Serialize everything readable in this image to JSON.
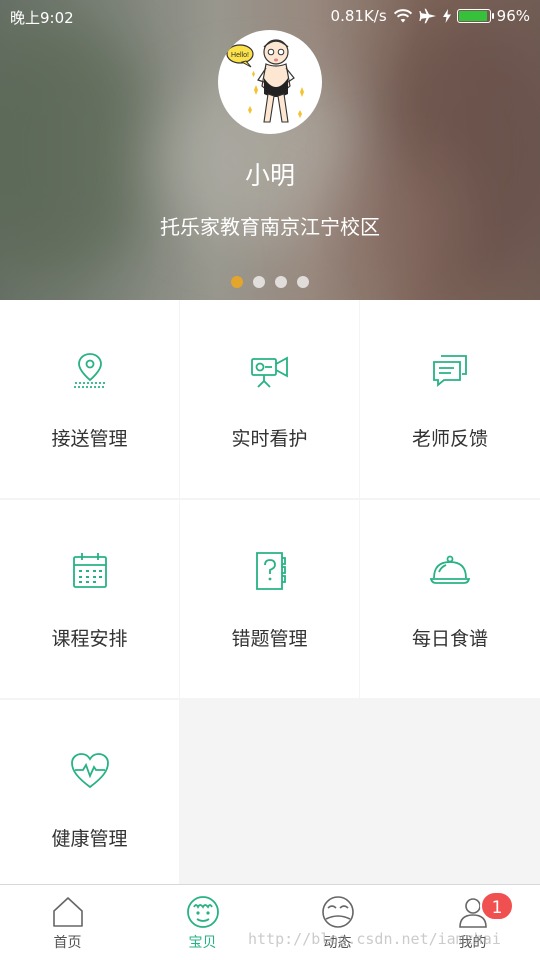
{
  "status_bar": {
    "time": "晚上9:02",
    "network_speed": "0.81K/s",
    "battery_percent": "96%",
    "battery_level": 0.96,
    "icons": [
      "wifi-icon",
      "airplane-icon",
      "charging-icon",
      "battery-icon"
    ]
  },
  "profile": {
    "name": "小明",
    "school": "托乐家教育南京江宁校区",
    "avatar_bubble": "Hello!"
  },
  "carousel": {
    "count": 4,
    "active_index": 0,
    "active_color": "#e4a52b"
  },
  "features": [
    {
      "label": "接送管理",
      "icon": "location-pin-icon"
    },
    {
      "label": "实时看护",
      "icon": "camera-icon"
    },
    {
      "label": "老师反馈",
      "icon": "chat-bubble-icon"
    },
    {
      "label": "课程安排",
      "icon": "calendar-icon"
    },
    {
      "label": "错题管理",
      "icon": "question-book-icon"
    },
    {
      "label": "每日食谱",
      "icon": "food-cloche-icon"
    },
    {
      "label": "健康管理",
      "icon": "heart-pulse-icon"
    }
  ],
  "tabbar": {
    "tabs": [
      {
        "label": "首页",
        "icon": "home-icon",
        "active": false
      },
      {
        "label": "宝贝",
        "icon": "baby-face-icon",
        "active": true
      },
      {
        "label": "动态",
        "icon": "moments-icon",
        "active": false
      },
      {
        "label": "我的",
        "icon": "profile-icon",
        "active": false,
        "badge": "1"
      }
    ]
  },
  "watermark": "http://blog.csdn.net/iamzhai",
  "colors": {
    "accent": "#27b283",
    "badge": "#f15050",
    "carousel_active": "#e4a52b"
  }
}
